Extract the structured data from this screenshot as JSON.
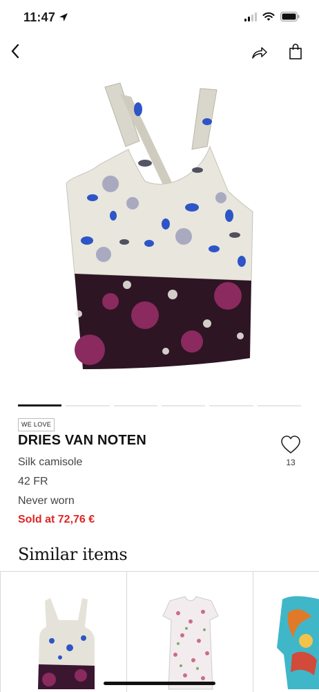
{
  "status_bar": {
    "time": "11:47"
  },
  "product": {
    "badge": "WE LOVE",
    "brand": "DRIES VAN NOTEN",
    "name": "Silk camisole",
    "size": "42 FR",
    "condition": "Never worn",
    "sold_label": "Sold at 72,76 €",
    "favorites_count": "13",
    "image_count": 6,
    "current_image": 1
  },
  "similar": {
    "title": "Similar items"
  },
  "colors": {
    "sold_red": "#e02424",
    "text_dark": "#111111"
  },
  "icons": [
    "back-icon",
    "share-icon",
    "shopping-bag-icon",
    "heart-icon",
    "location-arrow-icon",
    "signal-icon",
    "wifi-icon",
    "battery-icon"
  ]
}
